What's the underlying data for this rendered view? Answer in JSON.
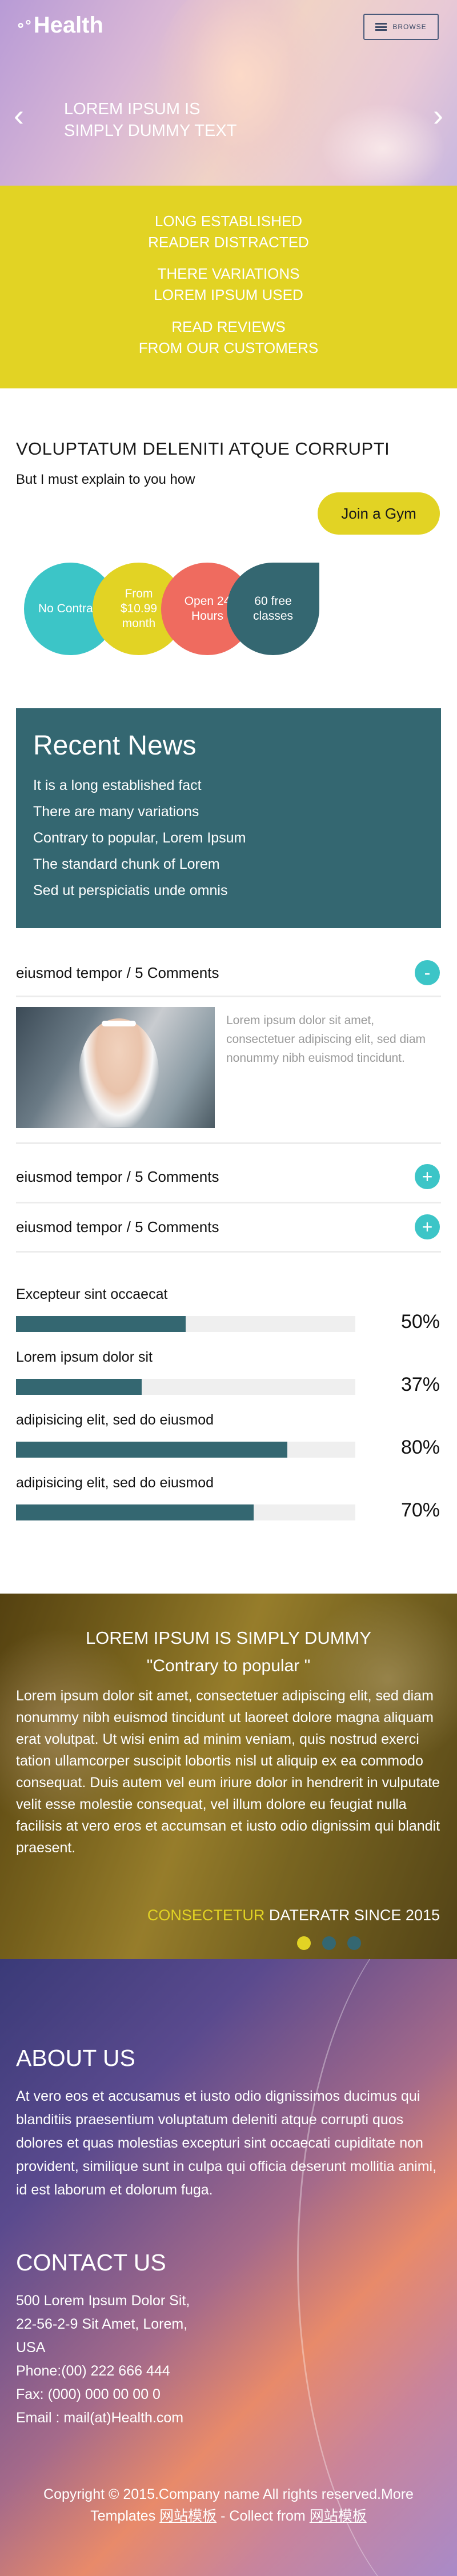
{
  "header": {
    "logo_text": "Health",
    "browse_label": "BROWSE"
  },
  "hero": {
    "line1": "LOREM IPSUM IS",
    "line2": "SIMPLY DUMMY TEXT"
  },
  "features": [
    [
      "LONG ESTABLISHED",
      "READER DISTRACTED"
    ],
    [
      "THERE VARIATIONS",
      "LOREM IPSUM USED"
    ],
    [
      "READ REVIEWS",
      "FROM OUR CUSTOMERS"
    ]
  ],
  "intro": {
    "title": "VOLUPTATUM DELENITI ATQUE CORRUPTI",
    "subtitle": "But I must explain to you how",
    "join_label": "Join a Gym"
  },
  "circles": [
    {
      "line1": "No Contract",
      "line2": "",
      "color": "#3cc5c7"
    },
    {
      "line1": "From",
      "line2": "$10.99",
      "line3": "month",
      "color": "#e2d324"
    },
    {
      "line1": "Open 24",
      "line2": "Hours",
      "color": "#ef6b5f"
    },
    {
      "line1": "60 free",
      "line2": "classes",
      "color": "#346771"
    }
  ],
  "news": {
    "title": "Recent News",
    "items": [
      "It is a long established fact",
      "There are many variations",
      "Contrary to popular, Lorem Ipsum",
      "The standard chunk of Lorem",
      "Sed ut perspiciatis unde omnis"
    ]
  },
  "accordion": {
    "items": [
      {
        "title": "eiusmod tempor / 5 Comments",
        "state": "-"
      },
      {
        "title": "eiusmod tempor / 5 Comments",
        "state": "+"
      },
      {
        "title": "eiusmod tempor / 5 Comments",
        "state": "+"
      }
    ],
    "open_text": "Lorem ipsum dolor sit amet, consectetuer adipiscing elit, sed diam nonummy nibh euismod tincidunt."
  },
  "skills": [
    {
      "label": "Excepteur sint occaecat",
      "percent": 50,
      "percent_text": "50%"
    },
    {
      "label": "Lorem ipsum dolor sit",
      "percent": 37,
      "percent_text": "37%"
    },
    {
      "label": "adipisicing elit, sed do eiusmod",
      "percent": 80,
      "percent_text": "80%"
    },
    {
      "label": "adipisicing elit, sed do eiusmod",
      "percent": 70,
      "percent_text": "70%"
    }
  ],
  "testimonial": {
    "heading": "LOREM IPSUM IS SIMPLY DUMMY",
    "quote": "\"Contrary to popular \"",
    "body": "Lorem ipsum dolor sit amet, consectetuer adipiscing elit, sed diam nonummy nibh euismod tincidunt ut laoreet dolore magna aliquam erat volutpat. Ut wisi enim ad minim veniam, quis nostrud exerci tation ullamcorper suscipit lobortis nisl ut aliquip ex ea commodo consequat. Duis autem vel eum iriure dolor in hendrerit in vulputate velit esse molestie consequat, vel illum dolore eu feugiat nulla facilisis at vero eros et accumsan et iusto odio dignissim qui blandit praesent.",
    "sig_highlight": "CONSECTETUR",
    "sig_rest": "DATERATR SINCE 2015"
  },
  "about": {
    "title": "ABOUT US",
    "text": "At vero eos et accusamus et iusto odio dignissimos ducimus qui blanditiis praesentium voluptatum deleniti atque corrupti quos dolores et quas molestias excepturi sint occaecati cupiditate non provident, similique sunt in culpa qui officia deserunt mollitia animi, id est laborum et dolorum fuga."
  },
  "contact": {
    "title": "CONTACT US",
    "address1": "500 Lorem Ipsum Dolor Sit,",
    "address2": "22-56-2-9 Sit Amet, Lorem,",
    "country": "USA",
    "phone": "Phone:(00) 222 666 444",
    "fax": "Fax: (000) 000 00 00 0",
    "email": "Email : mail(at)Health.com"
  },
  "footer": {
    "copy_prefix": "Copyright © 2015.Company name All rights reserved.More",
    "copy_line2_prefix": "Templates",
    "link1": "网站模板",
    "copy_mid": "- Collect from",
    "link2": "网站模板"
  },
  "colors": {
    "teal": "#346771",
    "cyan": "#3cc5c7",
    "yellow": "#e2d324",
    "coral": "#ef6b5f"
  }
}
